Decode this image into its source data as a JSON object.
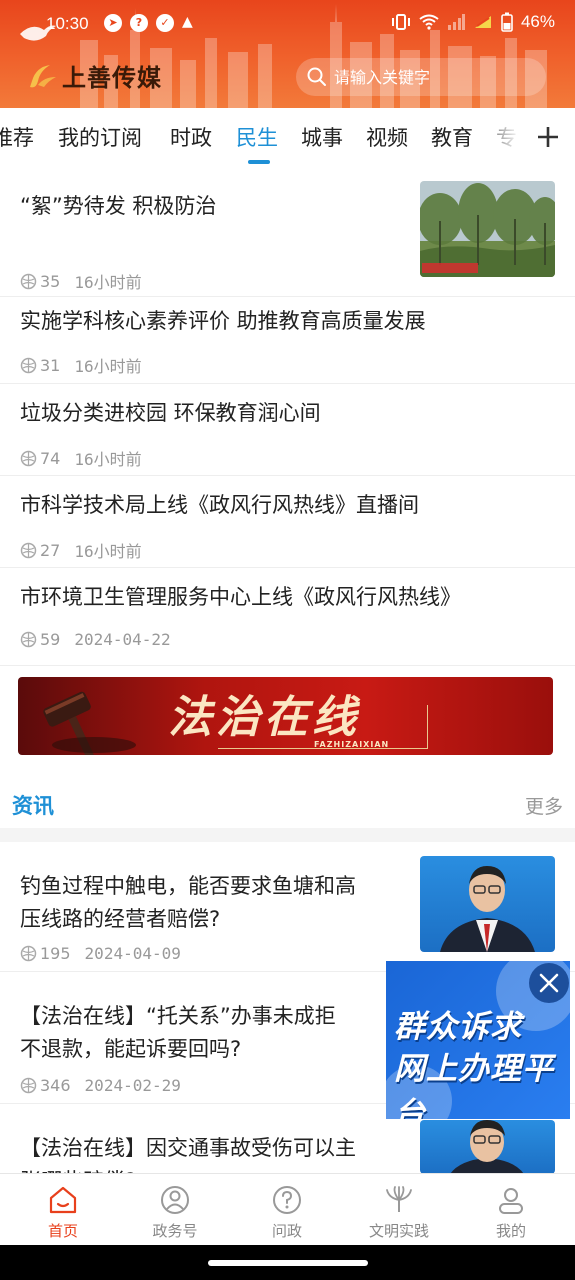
{
  "status_bar": {
    "time": "10:30",
    "battery": "46%"
  },
  "header": {
    "app_name": "上善传媒",
    "search_placeholder": "请输入关键字"
  },
  "tabs": [
    "推荐",
    "我的订阅",
    "时政",
    "民生",
    "城事",
    "视频",
    "教育",
    "专"
  ],
  "active_tab": "民生",
  "news": [
    {
      "title": "“絮”势待发  积极防治",
      "views": "35",
      "time": "16小时前",
      "has_thumb": true
    },
    {
      "title": "实施学科核心素养评价  助推教育高质量发展",
      "views": "31",
      "time": "16小时前"
    },
    {
      "title": "垃圾分类进校园  环保教育润心间",
      "views": "74",
      "time": "16小时前"
    },
    {
      "title": "市科学技术局上线《政风行风热线》直播间",
      "views": "27",
      "time": "16小时前"
    },
    {
      "title": "市环境卫生管理服务中心上线《政风行风热线》",
      "views": "59",
      "time": "2024-04-22"
    }
  ],
  "banner": {
    "title": "法治在线",
    "subtitle": "FAZHIZAIXIAN"
  },
  "section": {
    "title": "资讯",
    "more": "更多"
  },
  "info_news": [
    {
      "title_line1": "钓鱼过程中触电，能否要求鱼塘和高",
      "title_line2": "压线路的经营者赔偿?",
      "views": "195",
      "time": "2024-04-09"
    },
    {
      "title_line1": "【法治在线】“托关系”办事未成拒",
      "title_line2": "不退款，能起诉要回吗?",
      "views": "346",
      "time": "2024-02-29"
    },
    {
      "title_line1": "【法治在线】因交通事故受伤可以主",
      "title_line2": "张哪些赔偿?",
      "views": "",
      "time": ""
    }
  ],
  "float_ad": {
    "line1": "群众诉求",
    "line2": "网上办理平台"
  },
  "bottom_nav": [
    {
      "label": "首页",
      "icon": "home-icon",
      "active": true
    },
    {
      "label": "政务号",
      "icon": "government-account-icon",
      "active": false
    },
    {
      "label": "问政",
      "icon": "question-icon",
      "active": false
    },
    {
      "label": "文明实践",
      "icon": "civilization-practice-icon",
      "active": false
    },
    {
      "label": "我的",
      "icon": "profile-icon",
      "active": false
    }
  ],
  "colors": {
    "accent": "#1e90d6",
    "header": "#e8451c",
    "nav_active": "#e8401c"
  }
}
